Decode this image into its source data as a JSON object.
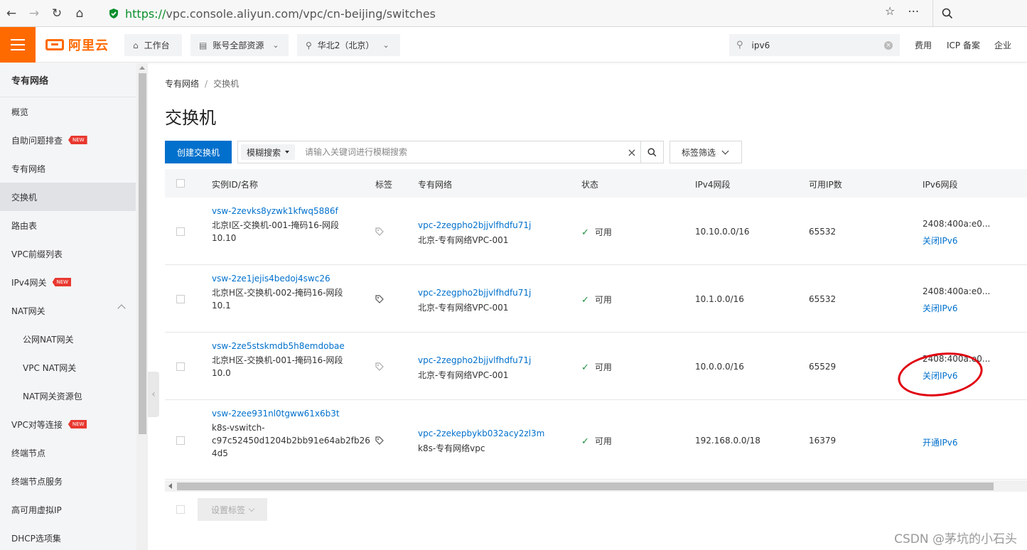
{
  "browser": {
    "url_scheme": "https://",
    "url_rest": "vpc.console.aliyun.com/vpc/cn-beijing/switches"
  },
  "header": {
    "brand": "阿里云",
    "workbench": "工作台",
    "resources": "账号全部资源",
    "region": "华北2（北京）",
    "search_value": "ipv6",
    "links": [
      "费用",
      "ICP 备案",
      "企业"
    ]
  },
  "sidebar": {
    "title": "专有网络",
    "items": [
      {
        "label": "概览"
      },
      {
        "label": "自助问题排查",
        "badge": "NEW"
      },
      {
        "label": "专有网络"
      },
      {
        "label": "交换机"
      },
      {
        "label": "路由表"
      },
      {
        "label": "VPC前缀列表"
      },
      {
        "label": "IPv4网关",
        "badge": "NEW"
      },
      {
        "label": "NAT网关"
      },
      {
        "label": "公网NAT网关"
      },
      {
        "label": "VPC NAT网关"
      },
      {
        "label": "NAT网关资源包"
      },
      {
        "label": "VPC对等连接",
        "badge": "NEW"
      },
      {
        "label": "终端节点"
      },
      {
        "label": "终端节点服务"
      },
      {
        "label": "高可用虚拟IP"
      },
      {
        "label": "DHCP选项集"
      }
    ]
  },
  "breadcrumb": {
    "root": "专有网络",
    "current": "交换机"
  },
  "page": {
    "title": "交换机",
    "create_button": "创建交换机",
    "search_type": "模糊搜索",
    "search_placeholder": "请输入关键词进行模糊搜索",
    "tag_filter": "标签筛选",
    "set_tag_button": "设置标签"
  },
  "table": {
    "headers": [
      "实例ID/名称",
      "标签",
      "专有网络",
      "状态",
      "IPv4网段",
      "可用IP数",
      "IPv6网段"
    ],
    "rows": [
      {
        "id": "vsw-2zevks8yzwk1kfwq5886f",
        "name1": "北京I区-交换机-001-掩码16-网段",
        "name2": "10.10",
        "vpc_id": "vpc-2zegpho2bjjvlfhdfu71j",
        "vpc_name": "北京-专有网络VPC-001",
        "status": "可用",
        "ipv4": "10.10.0.0/16",
        "available_ip": "65532",
        "ipv6": "2408:400a:e0...",
        "ipv6_action": "关闭IPv6"
      },
      {
        "id": "vsw-2ze1jejis4bedoj4swc26",
        "name1": "北京H区-交换机-002-掩码16-网段",
        "name2": "10.1",
        "vpc_id": "vpc-2zegpho2bjjvlfhdfu71j",
        "vpc_name": "北京-专有网络VPC-001",
        "status": "可用",
        "ipv4": "10.1.0.0/16",
        "available_ip": "65532",
        "ipv6": "2408:400a:e0...",
        "ipv6_action": "关闭IPv6"
      },
      {
        "id": "vsw-2ze5stskmdb5h8emdobae",
        "name1": "北京H区-交换机-001-掩码16-网段",
        "name2": "10.0",
        "vpc_id": "vpc-2zegpho2bjjvlfhdfu71j",
        "vpc_name": "北京-专有网络VPC-001",
        "status": "可用",
        "ipv4": "10.0.0.0/16",
        "available_ip": "65529",
        "ipv6": "2408:400a:e0...",
        "ipv6_action": "关闭IPv6"
      },
      {
        "id": "vsw-2zee931nl0tgww61x6b3t",
        "name1": "k8s-vswitch-",
        "name2": "c97c52450d1204b2bb91e64ab2fb26",
        "name3": "4d5",
        "vpc_id": "vpc-2zekepbykb032acy2zl3m",
        "vpc_name": "k8s-专有网络vpc",
        "status": "可用",
        "ipv4": "192.168.0.0/18",
        "available_ip": "16379",
        "ipv6": "",
        "ipv6_action": "开通IPv6"
      }
    ]
  },
  "watermark": "CSDN @茅坑的小石头",
  "colors": {
    "brand": "#ff6a00",
    "link": "#0070cc",
    "ok": "#1e8e3e",
    "annotation": "#e0000f"
  }
}
